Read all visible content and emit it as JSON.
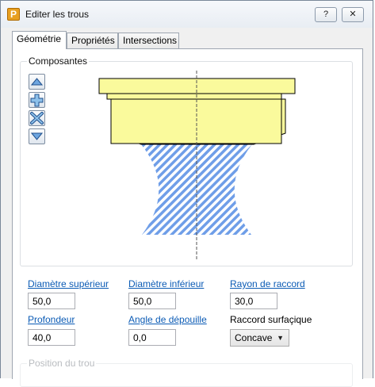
{
  "window": {
    "title": "Editer les trous",
    "app_icon_letter": "P",
    "help_label": "?",
    "close_label": "✕"
  },
  "tabs": [
    {
      "label": "Géométrie",
      "active": true
    },
    {
      "label": "Propriétés",
      "active": false
    },
    {
      "label": "Intersections",
      "active": false
    }
  ],
  "composantes": {
    "label": "Composantes",
    "buttons": [
      "move-up-icon",
      "add-icon",
      "delete-icon",
      "move-down-icon"
    ]
  },
  "colors": {
    "head_fill": "#fafa9c",
    "hatch": "#6f9ee8",
    "outline": "#000000",
    "link": "#0b5bb5"
  },
  "fields": {
    "diametre_superieur": {
      "label": "Diamètre supérieur",
      "value": "50,0"
    },
    "diametre_inferieur": {
      "label": "Diamètre inférieur",
      "value": "50,0"
    },
    "rayon_raccord": {
      "label": "Rayon de raccord",
      "value": "30,0"
    },
    "profondeur": {
      "label": "Profondeur",
      "value": "40,0"
    },
    "angle_depouille": {
      "label": "Angle de dépouille",
      "value": "0,0"
    },
    "raccord_surfacique": {
      "label": "Raccord surfaçique",
      "value": "Concave"
    }
  },
  "position": {
    "label": "Position du trou"
  }
}
